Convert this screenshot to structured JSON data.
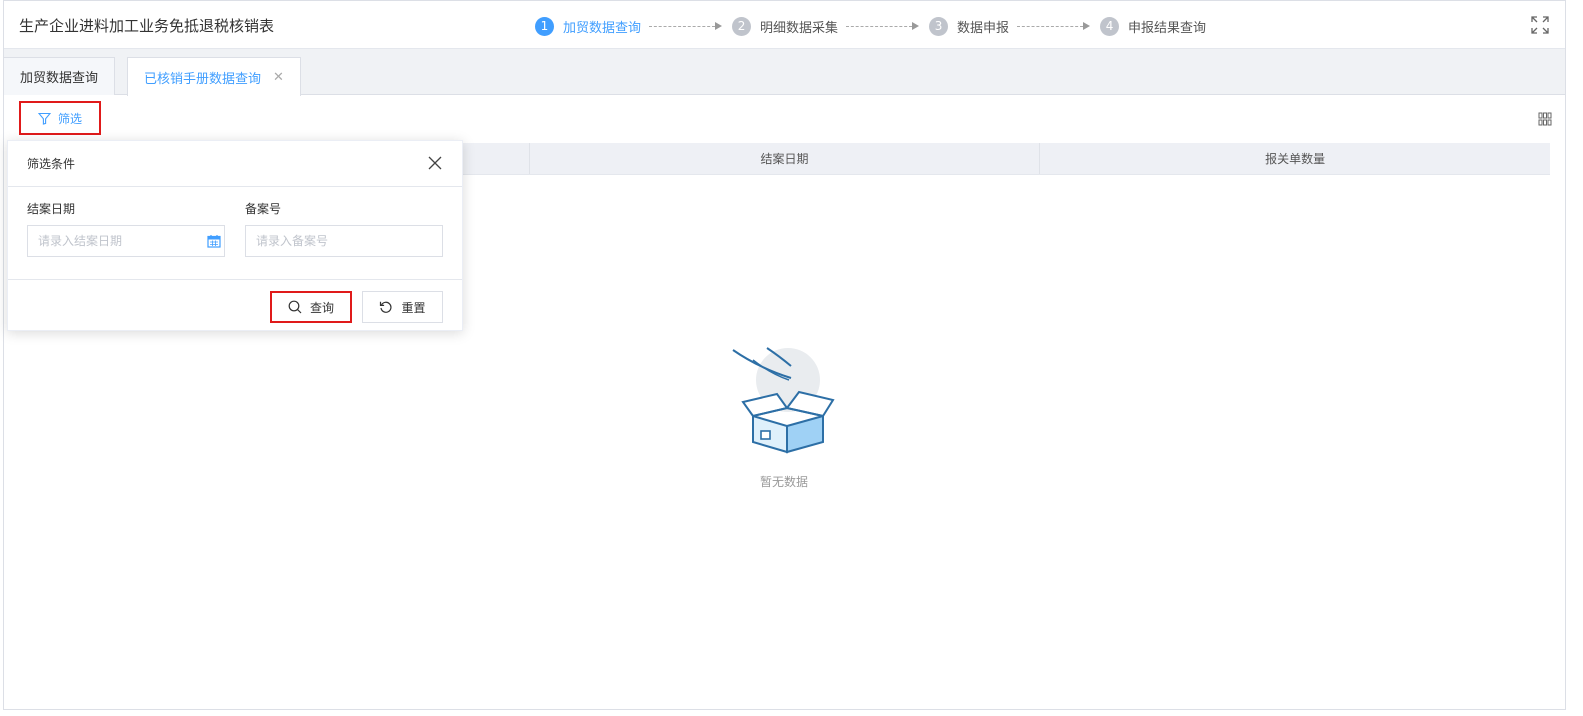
{
  "header": {
    "title": "生产企业进料加工业务免抵退税核销表",
    "steps": [
      {
        "num": "1",
        "label": "加贸数据查询",
        "active": true
      },
      {
        "num": "2",
        "label": "明细数据采集",
        "active": false
      },
      {
        "num": "3",
        "label": "数据申报",
        "active": false
      },
      {
        "num": "4",
        "label": "申报结果查询",
        "active": false
      }
    ],
    "fullscreen_icon": "expand-icon"
  },
  "tabs": [
    {
      "label": "加贸数据查询",
      "active": false
    },
    {
      "label": "已核销手册数据查询",
      "active": true,
      "closable": true,
      "close_symbol": "✕"
    }
  ],
  "toolbar": {
    "filter_label": "筛选",
    "filter_icon": "funnel-icon",
    "grid_icon": "grid-icon"
  },
  "table": {
    "columns": [
      "",
      "结案日期",
      "报关单数量"
    ]
  },
  "empty_state": {
    "text": "暂无数据",
    "icon": "empty-box-icon"
  },
  "filter_panel": {
    "title": "筛选条件",
    "fields": [
      {
        "label": "结案日期",
        "value": "",
        "placeholder": "请录入结案日期",
        "icon": "calendar-icon"
      },
      {
        "label": "备案号",
        "value": "",
        "placeholder": "请录入备案号"
      }
    ],
    "query_label": "查询",
    "reset_label": "重置"
  },
  "colors": {
    "accent": "#409eff",
    "highlight_border": "#e01a1a",
    "step_inactive": "#c0c4cc"
  }
}
